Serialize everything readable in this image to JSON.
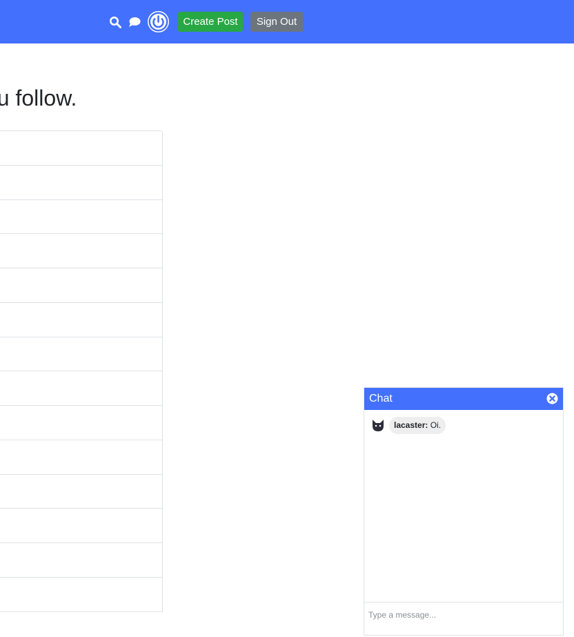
{
  "navbar": {
    "create_post_label": "Create Post",
    "sign_out_label": "Sign Out",
    "accent_color": "#4370fc"
  },
  "main": {
    "heading": "ou follow."
  },
  "chat": {
    "title": "Chat",
    "messages": [
      {
        "user": "lacaster:",
        "text": "Oi."
      }
    ],
    "input_placeholder": "Type a message..."
  }
}
